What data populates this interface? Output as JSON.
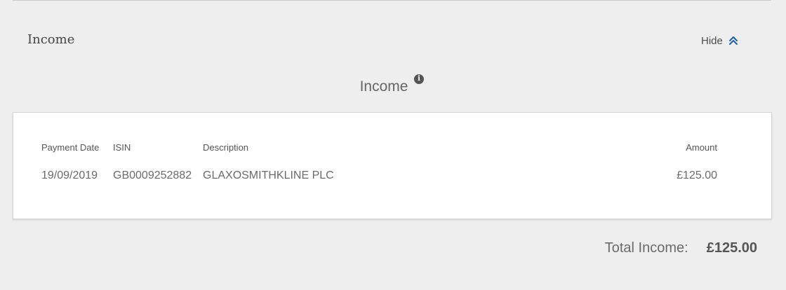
{
  "section": {
    "title": "Income",
    "toggle_label": "Hide",
    "toggle_icon": "double-chevron-up-icon",
    "accent_color": "#1e5fa8"
  },
  "panel": {
    "heading": "Income",
    "info_icon": "info-icon",
    "info_glyph": "i"
  },
  "table": {
    "headers": {
      "payment_date": "Payment Date",
      "isin": "ISIN",
      "description": "Description",
      "amount": "Amount"
    },
    "rows": [
      {
        "payment_date": "19/09/2019",
        "isin": "GB0009252882",
        "description": "GLAXOSMITHKLINE PLC",
        "amount": "£125.00"
      }
    ]
  },
  "total": {
    "label": "Total Income:",
    "value": "£125.00"
  }
}
